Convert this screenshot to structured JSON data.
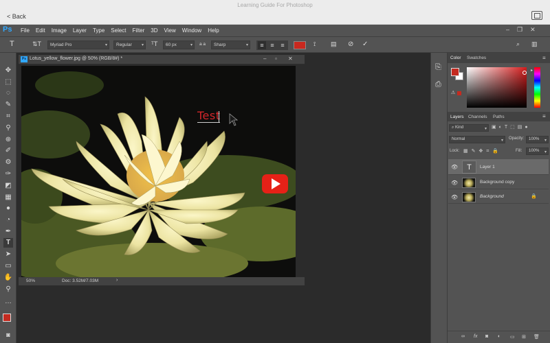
{
  "window": {
    "title": "Learning Guide For Photoshop",
    "back_label": "< Back"
  },
  "menubar": {
    "logo": "Ps",
    "items": [
      "File",
      "Edit",
      "Image",
      "Layer",
      "Type",
      "Select",
      "Filter",
      "3D",
      "View",
      "Window",
      "Help"
    ]
  },
  "options": {
    "font_family": "Myriad Pro",
    "font_style": "Regular",
    "font_size": "60 px",
    "antialias_prefix": "a a",
    "antialias": "Sharp",
    "text_color": "#c9291f"
  },
  "document": {
    "tab_title": "Lotus_yellow_flower.jpg @ 50% (RGB/8#) *",
    "zoom": "50%",
    "doc_info": "Doc: 3.52M/7.03M",
    "canvas_text": "Test",
    "text_color": "#d3262a"
  },
  "color_panel": {
    "tabs": [
      "Color",
      "Swatches"
    ],
    "foreground": "#c42b20",
    "background": "#ffffff"
  },
  "layers_panel": {
    "tabs": [
      "Layers",
      "Channels",
      "Paths"
    ],
    "kind_label": "Kind",
    "blend_mode": "Normal",
    "opacity_label": "Opacity:",
    "opacity_value": "100%",
    "lock_label": "Lock:",
    "fill_label": "Fill:",
    "fill_value": "100%",
    "layers": [
      {
        "name": "Layer 1",
        "type": "text"
      },
      {
        "name": "Background copy",
        "type": "image"
      },
      {
        "name": "Background",
        "type": "image"
      }
    ]
  }
}
